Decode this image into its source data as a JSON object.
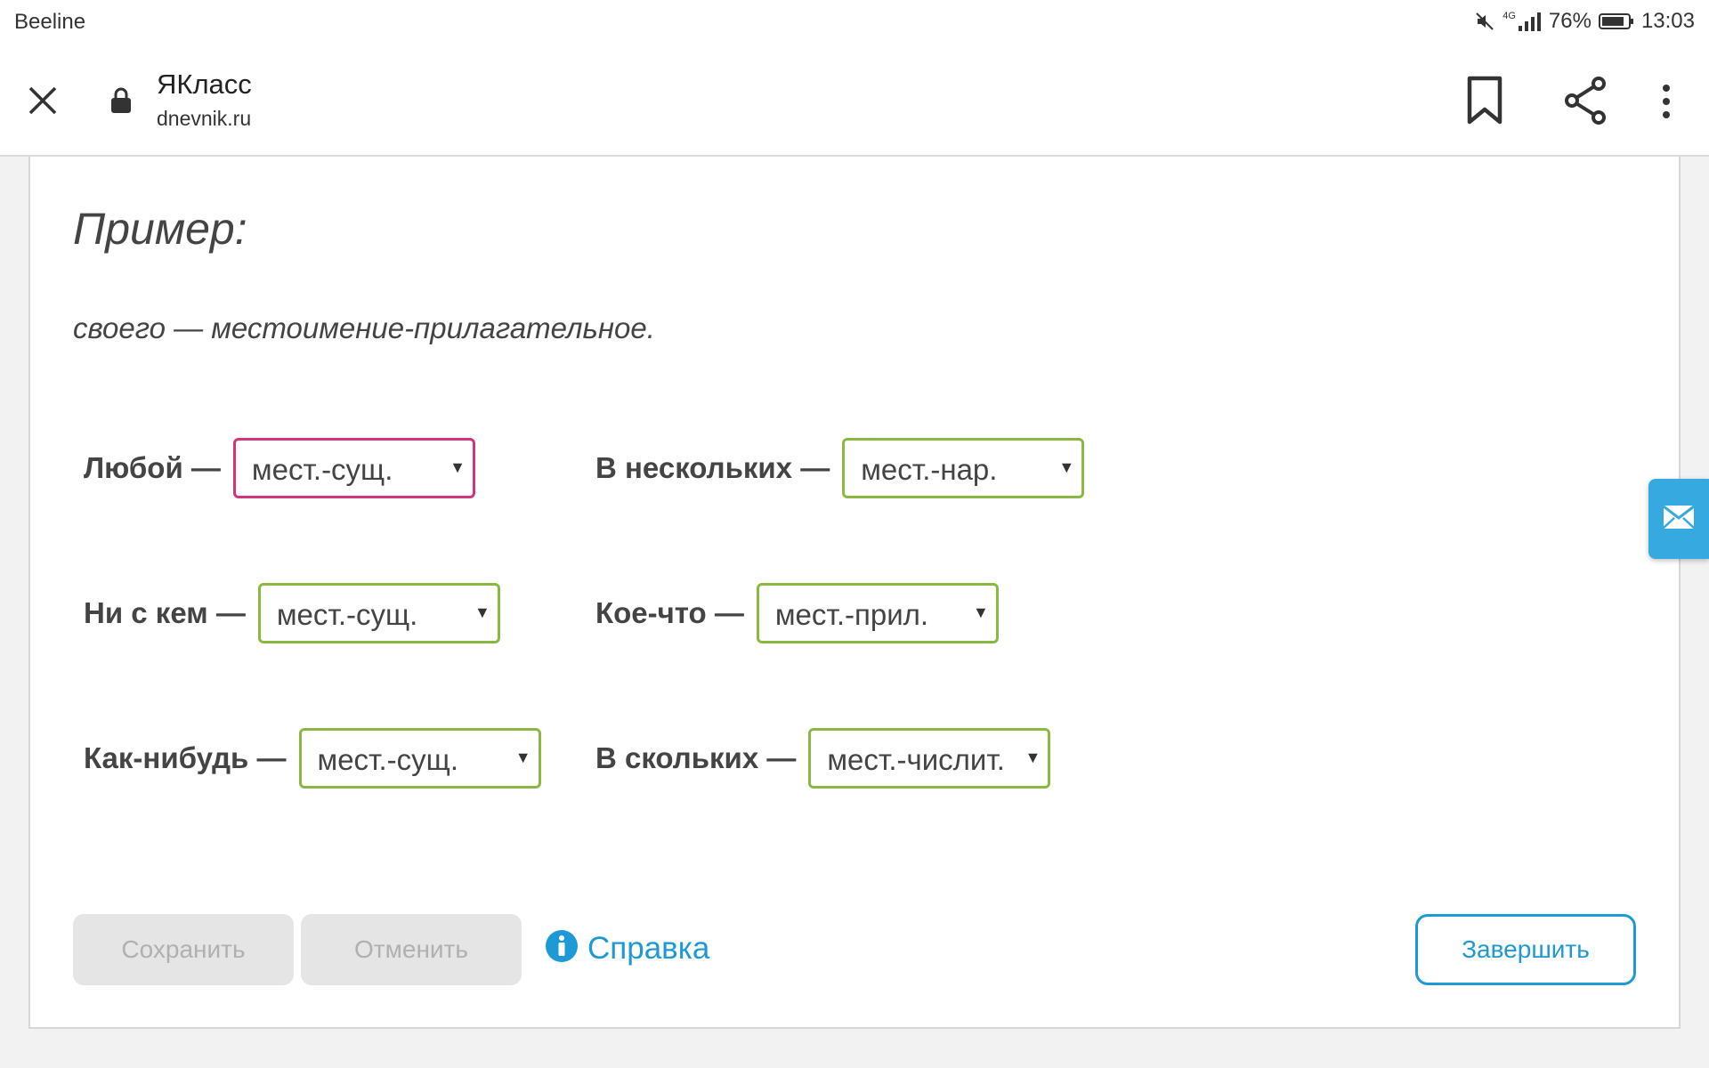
{
  "status_bar": {
    "carrier": "Beeline",
    "network": "4G",
    "battery": "76%",
    "time": "13:03"
  },
  "browser": {
    "site_title": "ЯКласс",
    "url": "dnevnik.ru"
  },
  "example": {
    "heading": "Пример:",
    "text": "своего — местоимение-прилагательное."
  },
  "items": [
    {
      "label": "Любой —",
      "value": "мест.-сущ."
    },
    {
      "label": "В нескольких —",
      "value": "мест.-нар."
    },
    {
      "label": "Ни с кем —",
      "value": "мест.-сущ."
    },
    {
      "label": "Кое-что —",
      "value": "мест.-прил."
    },
    {
      "label": "Как-нибудь —",
      "value": "мест.-сущ."
    },
    {
      "label": "В скольких —",
      "value": "мест.-числит."
    }
  ],
  "buttons": {
    "save": "Сохранить",
    "cancel": "Отменить",
    "help": "Справка",
    "finish": "Завершить"
  },
  "colors": {
    "select_border": "#8bb842",
    "active_select_border": "#d1357a",
    "accent_blue": "#1d9ad6",
    "mail_tab": "#35a9e0"
  },
  "icons": [
    "muted-speaker-icon",
    "signal-icon",
    "battery-icon",
    "close-icon",
    "lock-icon",
    "bookmark-icon",
    "share-icon",
    "more-vert-icon",
    "mail-icon",
    "info-icon",
    "chevron-down-icon"
  ]
}
